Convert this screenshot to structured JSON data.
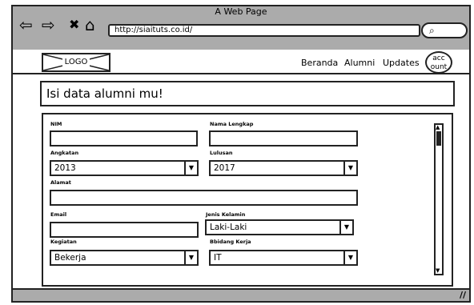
{
  "browser": {
    "title": "A Web Page",
    "back_icon": "⇦",
    "forward_icon": "⇨",
    "close_icon": "✖",
    "home_icon": "⌂",
    "url": "http://siaituts.co.id/",
    "search_icon": "⌕"
  },
  "navbar": {
    "logo": "LOGO",
    "links": [
      "Beranda",
      "Alumni",
      "Updates"
    ],
    "account": "acc ount"
  },
  "heading": "Isi data alumni mu!",
  "form": {
    "nim_label": "NIM",
    "nim_value": "",
    "nama_label": "Nama Lengkap",
    "nama_value": "",
    "angkatan_label": "Angkatan",
    "angkatan_value": "2013",
    "lulusan_label": "Lulusan",
    "lulusan_value": "2017",
    "alamat_label": "Alamat",
    "alamat_value": "",
    "email_label": "Email",
    "email_value": "",
    "jenis_label": "Jenis Kelamin",
    "jenis_value": "Laki-Laki",
    "kegiatan_label": "Kegiatan",
    "kegiatan_value": "Bekerja",
    "bidang_label": "Bbidang Kerja",
    "bidang_value": "IT"
  },
  "icons": {
    "dropdown": "▼",
    "scroll_up": "▲",
    "scroll_down": "▼",
    "resize_grip": "//"
  }
}
